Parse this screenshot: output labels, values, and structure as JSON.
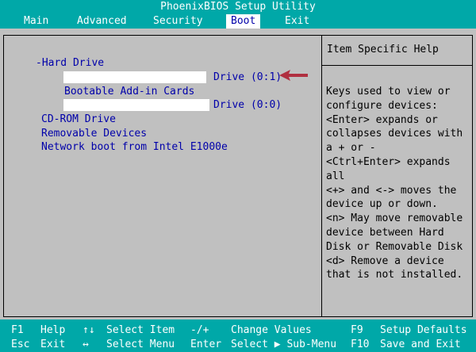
{
  "title": "PhoenixBIOS Setup Utility",
  "menu": [
    {
      "label": "Main"
    },
    {
      "label": "Advanced"
    },
    {
      "label": "Security"
    },
    {
      "label": "Boot"
    },
    {
      "label": "Exit"
    }
  ],
  "boot_list": {
    "hard_drive": "-Hard Drive",
    "drive_0_1": "Drive (0:1)",
    "bootable_addin": "Bootable Add-in Cards",
    "drive_0_0": "Drive (0:0)",
    "cdrom": "CD-ROM Drive",
    "removable": "Removable Devices",
    "network": "Network boot from Intel E1000e"
  },
  "help": {
    "title": "Item Specific Help",
    "lines": [
      "Keys used to view or",
      "configure devices:",
      "<Enter> expands or",
      "collapses devices with",
      "a + or -",
      "<Ctrl+Enter> expands",
      "all",
      "<+> and <-> moves the",
      "device up or down.",
      "<n> May move removable",
      "device between Hard",
      "Disk or Removable Disk",
      "<d> Remove a device",
      "that is not installed."
    ]
  },
  "footer": {
    "f1_key": "F1",
    "f1_label": "Help",
    "esc_key": "Esc",
    "esc_label": "Exit",
    "updown_key": "↑↓",
    "updown_label": "Select Item",
    "leftright_key": "↔",
    "leftright_label": "Select Menu",
    "pm_key": "-/+",
    "pm_label": "Change Values",
    "enter_key": "Enter",
    "enter_label": "Select ▶ Sub-Menu",
    "f9_key": "F9",
    "f9_label": "Setup Defaults",
    "f10_key": "F10",
    "f10_label": "Save and Exit"
  },
  "colors": {
    "background": "#0000aa",
    "bar": "#00a8a8",
    "panel": "#c0c0c0",
    "arrow": "#b03040"
  },
  "icons": [
    "pointer-arrow-icon",
    "up-down-arrows-icon",
    "left-right-arrows-icon",
    "submenu-triangle-icon"
  ]
}
